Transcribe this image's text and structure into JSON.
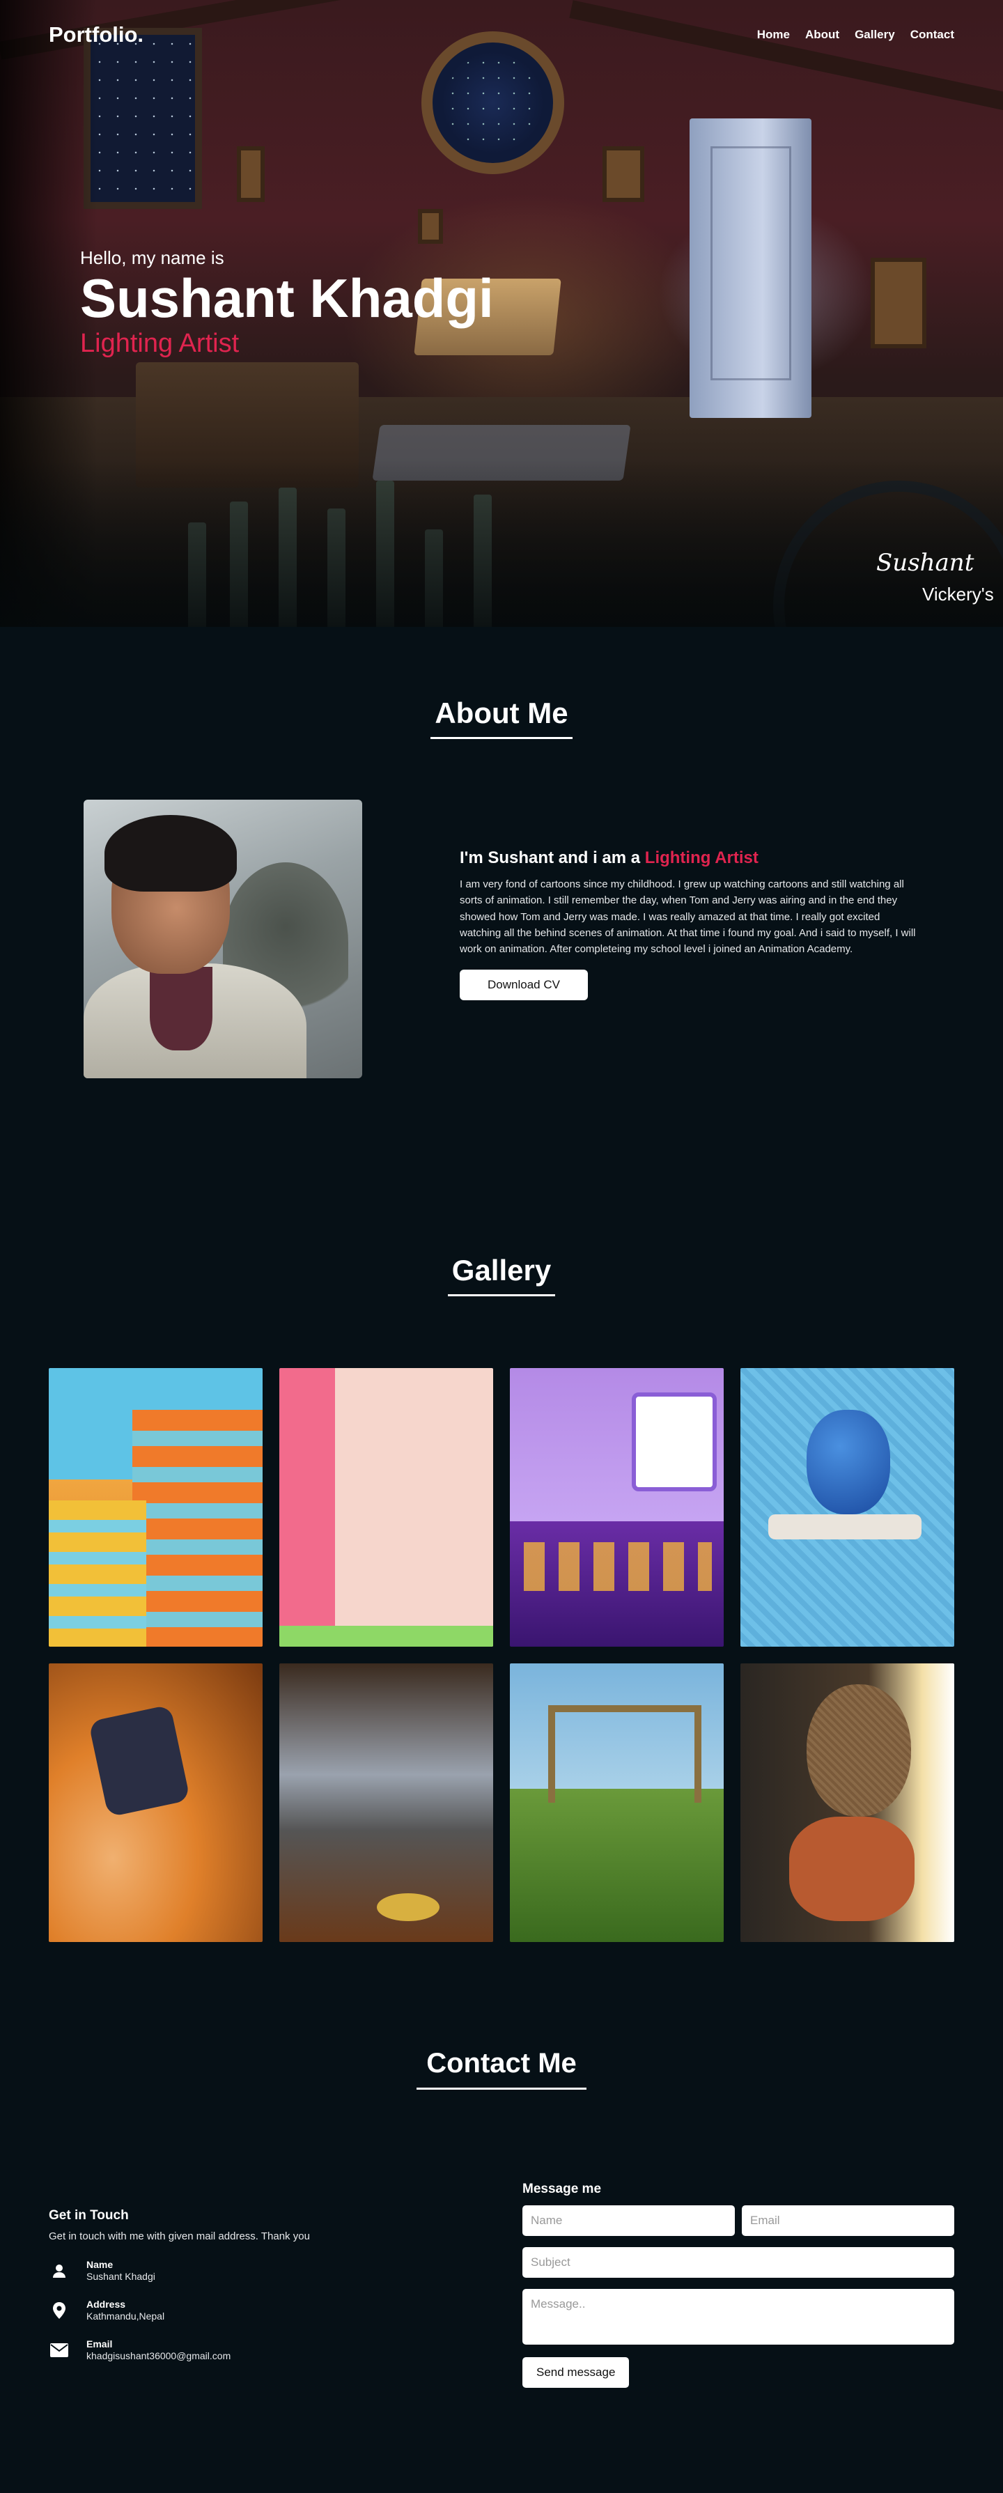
{
  "nav": {
    "logo": "Portfolio.",
    "links": [
      "Home",
      "About",
      "Gallery",
      "Contact"
    ]
  },
  "hero": {
    "hello": "Hello, my name is",
    "name": "Sushant Khadgi",
    "role": "Lighting Artist",
    "signature": "Sushant",
    "signature_sub": "Vickery's"
  },
  "about": {
    "title": "About Me",
    "heading_prefix": "I'm Sushant and i am a",
    "heading_accent": "Lighting Artist",
    "body": "I am very fond of cartoons since my childhood. I grew up watching cartoons and still watching all sorts of animation. I still remember the day, when Tom and Jerry was airing and in the end they showed how Tom and Jerry was made. I was really amazed at that time. I really got excited watching all the behind scenes of animation. At that time i found my goal. And i said to myself, I will work on animation. After completeing my school level i joined an Animation Academy.",
    "cv_button": "Download CV"
  },
  "gallery": {
    "title": "Gallery"
  },
  "contact": {
    "title": "Contact Me",
    "get_in_touch": "Get in Touch",
    "subtitle": "Get in touch with me with given mail address. Thank you",
    "info": [
      {
        "label": "Name",
        "value": "Sushant Khadgi",
        "icon": "user-icon"
      },
      {
        "label": "Address",
        "value": "Kathmandu,Nepal",
        "icon": "location-pin-icon"
      },
      {
        "label": "Email",
        "value": "khadgisushant36000@gmail.com",
        "icon": "envelope-icon"
      }
    ],
    "form": {
      "title": "Message me",
      "name_placeholder": "Name",
      "email_placeholder": "Email",
      "subject_placeholder": "Subject",
      "message_placeholder": "Message..",
      "send_button": "Send message"
    }
  },
  "colors": {
    "accent": "#e0244f",
    "background": "#061016"
  }
}
